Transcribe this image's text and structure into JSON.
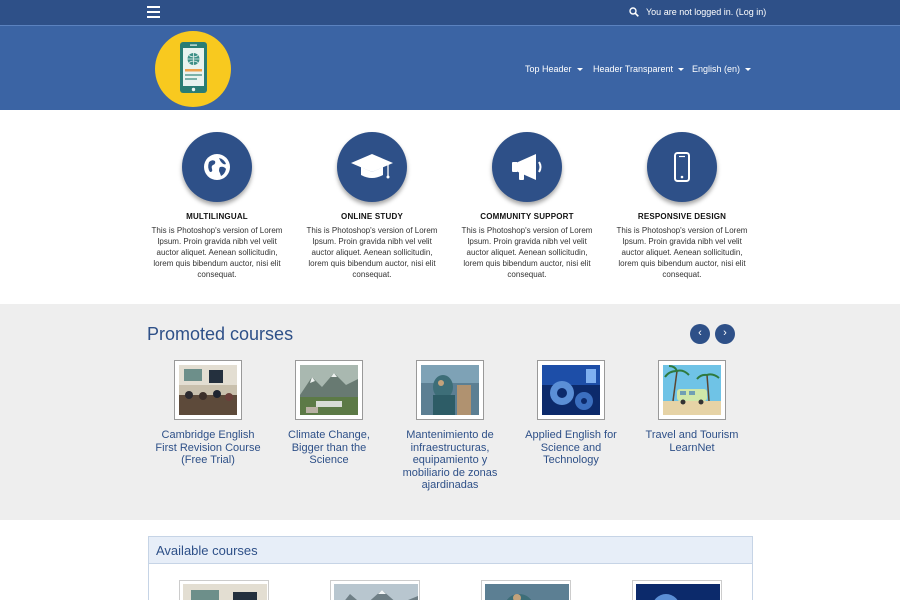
{
  "topbar": {
    "menu_icon": "hamburger-menu-icon",
    "search_icon": "search-icon",
    "login_prefix": "You are not logged in. (",
    "login_link": "Log in",
    "login_suffix": ")"
  },
  "header": {
    "logo_icon": "phone-globe-logo",
    "menu": [
      {
        "label": "Top Header"
      },
      {
        "label": "Header Transparent"
      },
      {
        "label": "English (en)"
      }
    ]
  },
  "features": [
    {
      "icon": "globe-icon",
      "title": "MULTILINGUAL",
      "text": "This is Photoshop's version of Lorem Ipsum. Proin gravida nibh vel velit auctor aliquet. Aenean sollicitudin, lorem quis bibendum auctor, nisi elit consequat."
    },
    {
      "icon": "graduation-cap-icon",
      "title": "ONLINE STUDY",
      "text": "This is Photoshop's version of Lorem Ipsum. Proin gravida nibh vel velit auctor aliquet. Aenean sollicitudin, lorem quis bibendum auctor, nisi elit consequat."
    },
    {
      "icon": "megaphone-icon",
      "title": "COMMUNITY SUPPORT",
      "text": "This is Photoshop's version of Lorem Ipsum. Proin gravida nibh vel velit auctor aliquet. Aenean sollicitudin, lorem quis bibendum auctor, nisi elit consequat."
    },
    {
      "icon": "mobile-phone-icon",
      "title": "RESPONSIVE DESIGN",
      "text": "This is Photoshop's version of Lorem Ipsum. Proin gravida nibh vel velit auctor aliquet. Aenean sollicitudin, lorem quis bibendum auctor, nisi elit consequat."
    }
  ],
  "promoted": {
    "title": "Promoted courses",
    "prev_label": "‹",
    "next_label": "›",
    "courses": [
      {
        "title": "Cambridge English First Revision Course (Free Trial)"
      },
      {
        "title": "Climate Change, Bigger than the Science"
      },
      {
        "title": "Mantenimiento de infraestructuras, equipamiento y mobiliario de zonas ajardinadas"
      },
      {
        "title": "Applied English for Science and Technology"
      },
      {
        "title": "Travel and Tourism LearnNet"
      }
    ]
  },
  "available": {
    "title": "Available courses"
  },
  "colors": {
    "navbar": "#2e5088",
    "header": "#3b64a4",
    "accent": "#2e5088",
    "logo_bg": "#f8c91f",
    "promoted_bg": "#eeeeee"
  }
}
